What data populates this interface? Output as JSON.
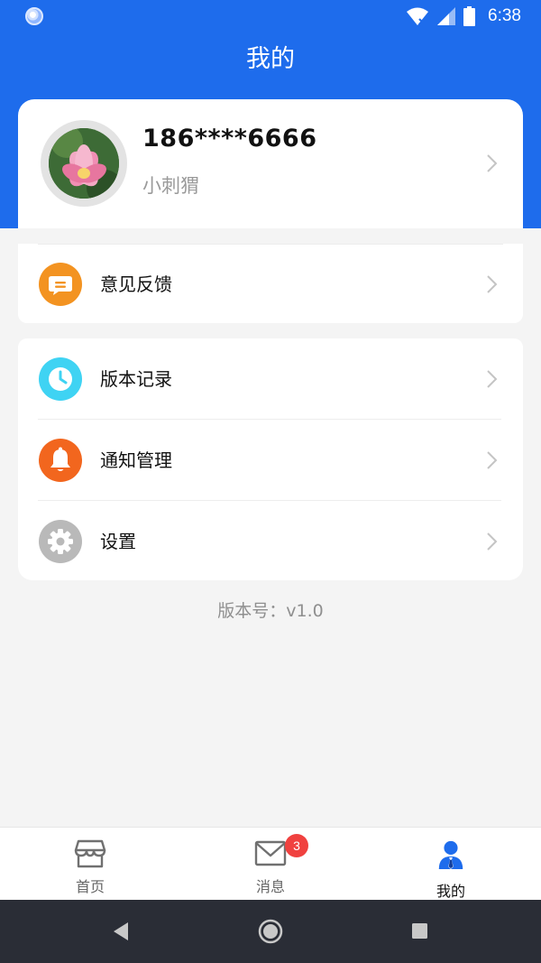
{
  "status_bar": {
    "time": "6:38"
  },
  "header": {
    "title": "我的"
  },
  "profile": {
    "phone": "186****6666",
    "nickname": "小刺猬"
  },
  "menu": {
    "feedback": {
      "label": "意见反馈",
      "icon": "chat-bubble-icon",
      "color": "#f39321"
    },
    "items": [
      {
        "label": "版本记录",
        "icon": "clock-icon",
        "color": "#3fd3f3"
      },
      {
        "label": "通知管理",
        "icon": "bell-icon",
        "color": "#f2661e"
      },
      {
        "label": "设置",
        "icon": "gear-icon",
        "color": "#b9b9b9"
      }
    ]
  },
  "version": {
    "text": "版本号：v1.0"
  },
  "tabs": [
    {
      "label": "首页",
      "icon": "store-icon",
      "active": false
    },
    {
      "label": "消息",
      "icon": "mail-icon",
      "active": false,
      "badge": "3"
    },
    {
      "label": "我的",
      "icon": "user-icon",
      "active": true
    }
  ],
  "colors": {
    "primary": "#1e6cec",
    "badge": "#f0413f"
  }
}
